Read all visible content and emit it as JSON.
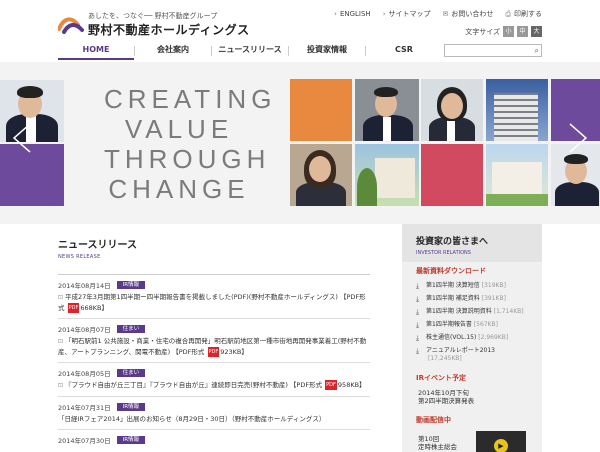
{
  "header": {
    "tagline": "あしたを、つなぐ── 野村不動産グループ",
    "company": "野村不動産ホールディングス",
    "util": {
      "english": "ENGLISH",
      "sitemap": "サイトマップ",
      "contact": "お問い合わせ",
      "print": "印刷する"
    },
    "font_size_label": "文字サイズ",
    "font_sizes": [
      "小",
      "中",
      "大"
    ],
    "nav": [
      "HOME",
      "会社案内",
      "ニュースリリース",
      "投資家情報",
      "CSR"
    ],
    "search_placeholder": ""
  },
  "hero": {
    "line1": "CREATING",
    "line2": "VALUE",
    "line3": "THROUGH",
    "line4": "CHANGE"
  },
  "colors": {
    "accent": "#5b3a8c",
    "orange": "#e8893f",
    "purple_tile": "#6d4a9b",
    "rose_tile": "#d14a5f",
    "pdf_red": "#d9262c"
  },
  "news": {
    "title": "ニュースリリース",
    "subtitle": "NEWS RELEASE",
    "items": [
      {
        "date": "2014年08月14日",
        "tag": "IR情報",
        "text": "平成27年3月期第1四半期ー四半期報告書を掲載しました(PDF)(野村不動産ホールディングス) 【PDF形式",
        "pdf": "668KB】"
      },
      {
        "date": "2014年08月07日",
        "tag": "住まい",
        "text": "明石駅前地区第一種市街地再開発事業着工(野村不動産、アートプランニング、関電不動産) 【PDF形式",
        "prefix": "「明石駅前1 公共施設・商業・住宅の複合再開発」",
        "pdf": "923KB】"
      },
      {
        "date": "2014年08月05日",
        "tag": "住まい",
        "text": "『プラウド自由が丘三丁目』『プラウド自由が丘』連続即日完売(野村不動産) 【PDF形式",
        "pdf": "958KB】"
      },
      {
        "date": "2014年07月31日",
        "tag": "IR情報",
        "text": "「日経IRフェア2014」出展のお知らせ（8月29日・30日）（野村不動産ホールディングス）",
        "pdf": ""
      },
      {
        "date": "2014年07月30日",
        "tag": "IR情報",
        "text": "",
        "pdf": ""
      }
    ]
  },
  "side": {
    "title": "投資家の皆さまへ",
    "subtitle": "INVESTOR RELATIONS",
    "downloads_title": "最新資料ダウンロード",
    "downloads": [
      {
        "label": "第1四半期 決算短信",
        "size": "[319KB]"
      },
      {
        "label": "第1四半期 補足資料",
        "size": "[391KB]"
      },
      {
        "label": "第1四半期 決算説明資料",
        "size": "[1,714KB]"
      },
      {
        "label": "第1四半期報告書",
        "size": "[567KB]"
      },
      {
        "label": "株主通信(VOL.15)",
        "size": "[2,969KB]"
      },
      {
        "label": "アニュアルレポート2013",
        "size": "[17,245KB]"
      }
    ],
    "event_title": "IRイベント予定",
    "event_line1": "2014年10月下旬",
    "event_line2": "第2四半期決算発表",
    "video_title": "動画配信中",
    "video_line1": "第10回",
    "video_line2": "定時株主総会"
  }
}
